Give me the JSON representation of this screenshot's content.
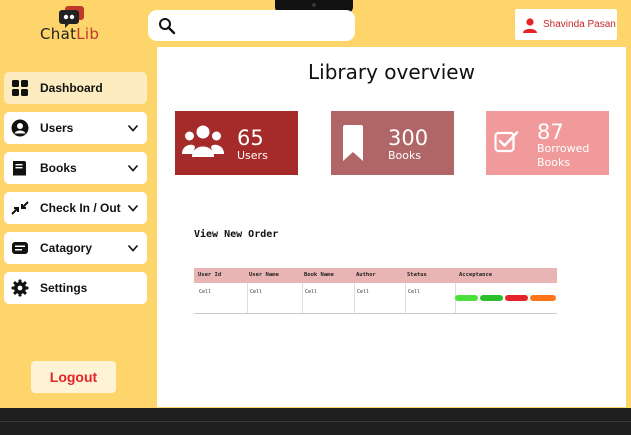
{
  "app": {
    "logo_part1": "Chat",
    "logo_part2": "Lib"
  },
  "search": {
    "placeholder": "",
    "value": ""
  },
  "user": {
    "name": "Shavinda Pasan"
  },
  "sidebar": {
    "items": [
      {
        "label": "Dashboard",
        "icon": "grid-icon",
        "active": true
      },
      {
        "label": "Users",
        "icon": "user-circle-icon"
      },
      {
        "label": "Books",
        "icon": "book-icon"
      },
      {
        "label": "Check In / Out",
        "icon": "swap-arrows-icon"
      },
      {
        "label": "Catagory",
        "icon": "category-icon"
      },
      {
        "label": "Settings",
        "icon": "gear-icon"
      }
    ],
    "logout_label": "Logout"
  },
  "main": {
    "title": "Library overview",
    "stats": [
      {
        "value": "65",
        "label": "Users",
        "icon": "users-icon",
        "color": "#A52A2A"
      },
      {
        "value": "300",
        "label": "Books",
        "icon": "bookmark-icon",
        "color": "#B06566"
      },
      {
        "value": "87",
        "label_line1": "Borrowed",
        "label_line2": "Books",
        "icon": "checkbox-icon",
        "color": "#F09A9B"
      }
    ],
    "orders": {
      "title": "View New Order",
      "columns": [
        "User Id",
        "User Name",
        "Book Name",
        "Author",
        "Status",
        "Acceptance"
      ],
      "rows": [
        [
          "Cell",
          "Cell",
          "Cell",
          "Cell",
          "Cell"
        ]
      ],
      "acceptance_colors": [
        "#4CE03A",
        "#2ABF2A",
        "#E5232A",
        "#FF7418"
      ]
    }
  },
  "colors": {
    "background": "#FDD56B",
    "accent": "#C62828"
  }
}
